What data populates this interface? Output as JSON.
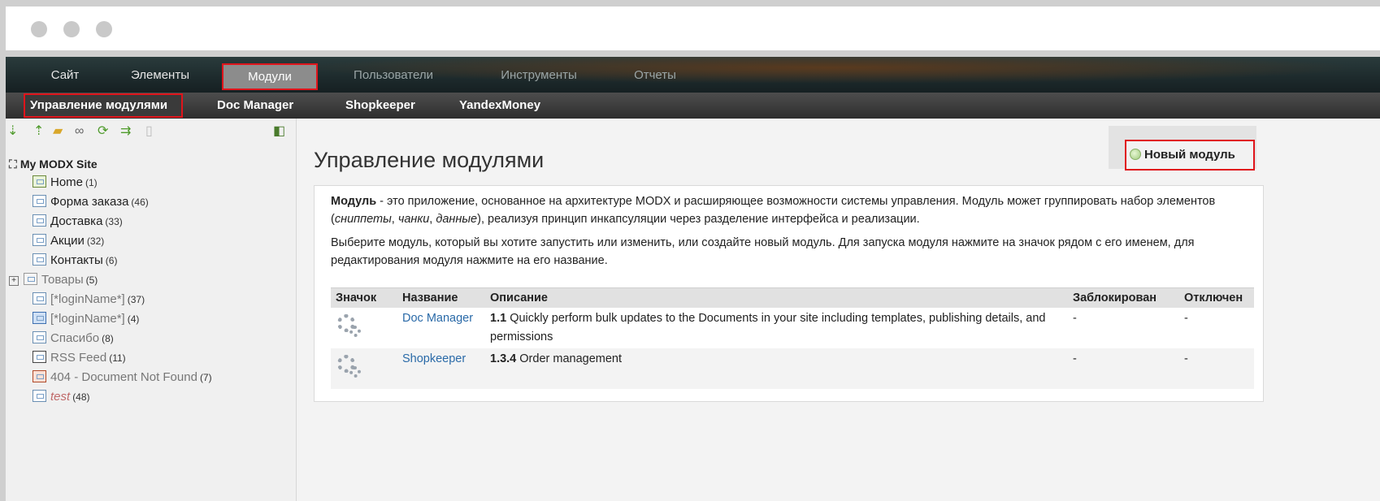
{
  "topnav": {
    "items": [
      "Сайт",
      "Элементы",
      "Модули",
      "Пользователи",
      "Инструменты",
      "Отчеты"
    ],
    "active": "Модули"
  },
  "subnav": {
    "items": [
      "Управление модулями",
      "Doc Manager",
      "Shopkeeper",
      "YandexMoney"
    ],
    "active": "Управление модулями"
  },
  "sidebar": {
    "toolbar_icons": [
      "arrow-down-icon",
      "arrow-up-icon",
      "new-folder-icon",
      "link-icon",
      "refresh-icon",
      "sort-icon",
      "trash-icon",
      "collapse-panel-icon"
    ],
    "tree": {
      "root": "My MODX Site",
      "items": [
        {
          "label": "Home",
          "count": "(1)",
          "style": "home"
        },
        {
          "label": "Форма заказа",
          "count": "(46)",
          "style": "normal"
        },
        {
          "label": "Доставка",
          "count": "(33)",
          "style": "normal"
        },
        {
          "label": "Акции",
          "count": "(32)",
          "style": "normal"
        },
        {
          "label": "Контакты",
          "count": "(6)",
          "style": "normal"
        },
        {
          "label": "Товары",
          "count": "(5)",
          "style": "folder-gray"
        },
        {
          "label": "[*loginName*]",
          "count": "(37)",
          "style": "gray"
        },
        {
          "label": "[*loginName*]",
          "count": "(4)",
          "style": "gray-info"
        },
        {
          "label": "Спасибо",
          "count": "(8)",
          "style": "gray"
        },
        {
          "label": "RSS Feed",
          "count": "(11)",
          "style": "gray-code"
        },
        {
          "label": "404 - Document Not Found",
          "count": "(7)",
          "style": "gray-404"
        },
        {
          "label": "test",
          "count": "(48)",
          "style": "italic"
        }
      ]
    }
  },
  "main": {
    "title": "Управление модулями",
    "new_button": "Новый модуль",
    "intro": {
      "bold": "Модуль",
      "p1_a": " - это приложение, основанное на архитектуре MODX и расширяющее возможности системы управления. Модуль может группировать набор элементов (",
      "p1_i1": "сниппеты",
      "p1_s1": ", ",
      "p1_i2": "чанки",
      "p1_s2": ", ",
      "p1_i3": "данные",
      "p1_b": "), реализуя принцип инкапсуляции через разделение интерфейса и реализации.",
      "p2": "Выберите модуль, который вы хотите запустить или изменить, или создайте новый модуль. Для запуска модуля нажмите на значок рядом с его именем, для редактирования модуля нажмите на его название."
    },
    "table": {
      "headers": [
        "Значок",
        "Название",
        "Описание",
        "Заблокирован",
        "Отключен"
      ],
      "rows": [
        {
          "name": "Doc Manager",
          "version": "1.1",
          "desc": " Quickly perform bulk updates to the Documents in your site including templates, publishing details, and permissions",
          "locked": "-",
          "disabled": "-"
        },
        {
          "name": "Shopkeeper",
          "version": "1.3.4",
          "desc": " Order management",
          "locked": "-",
          "disabled": "-"
        }
      ]
    }
  }
}
